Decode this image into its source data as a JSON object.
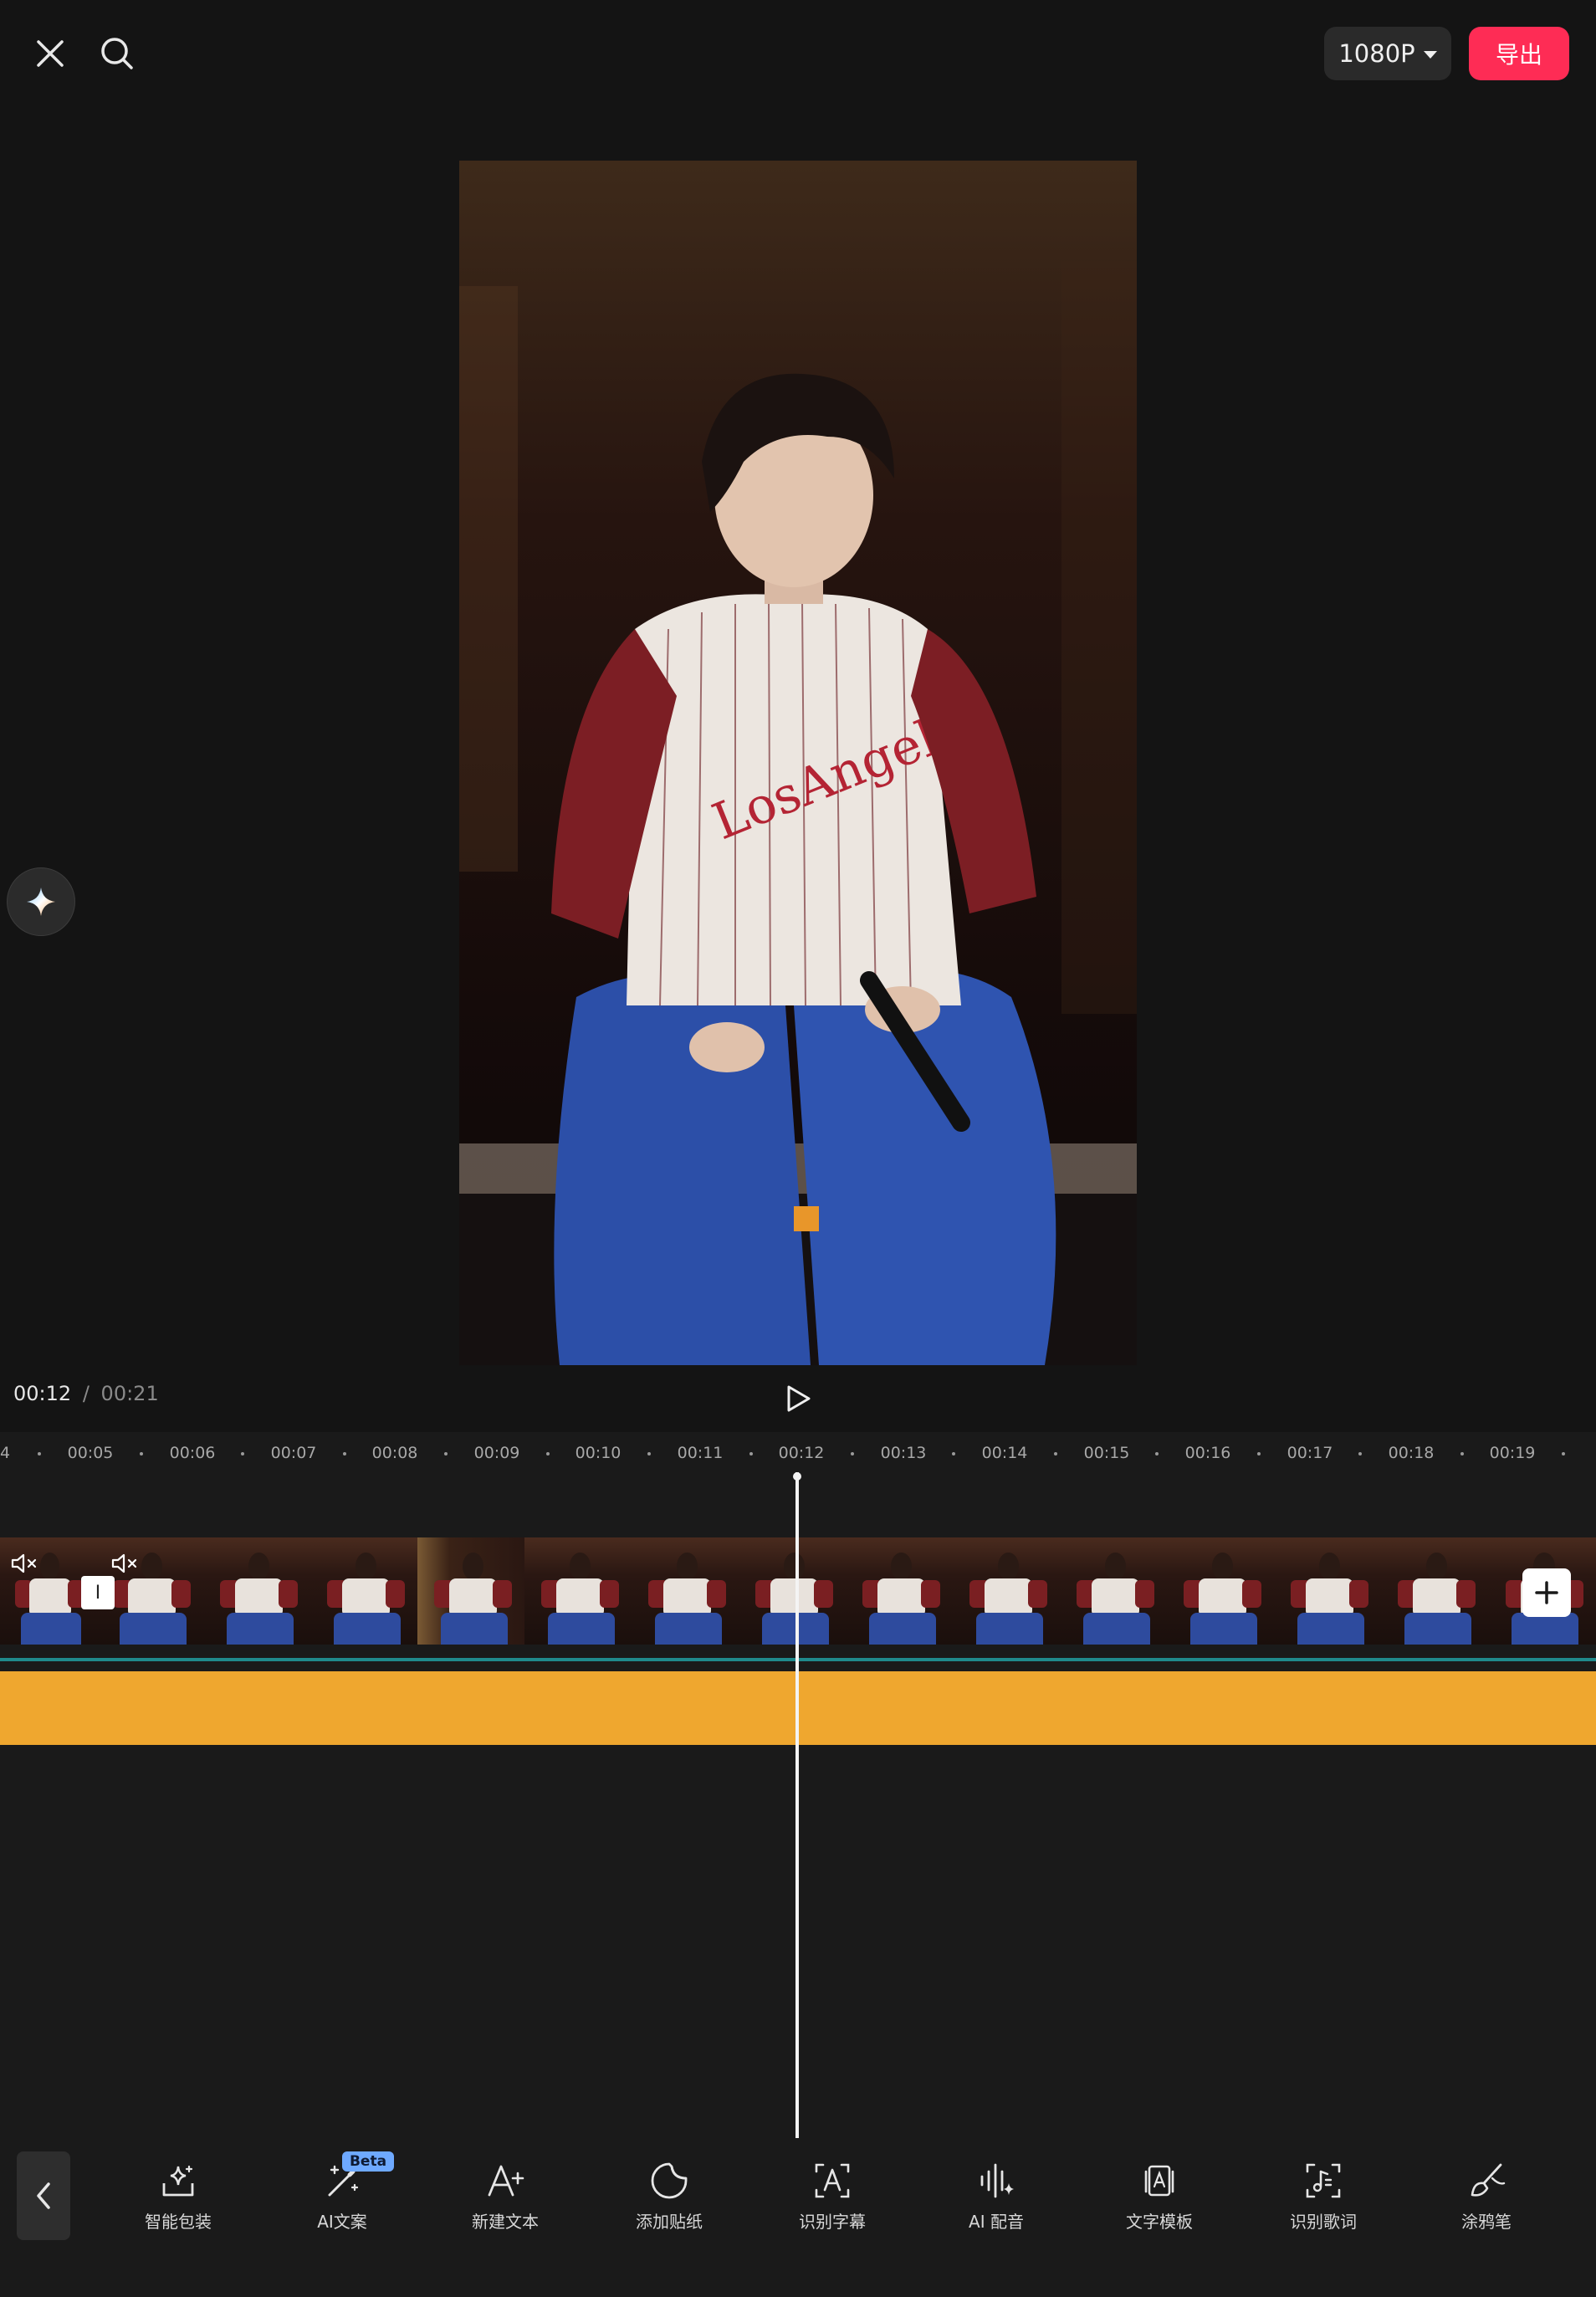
{
  "top_bar": {
    "close_icon": "close-icon",
    "search_icon": "search-icon",
    "resolution_label": "1080P",
    "export_label": "导出",
    "export_color": "#fe2c55"
  },
  "preview": {
    "description_icon": "video-frame",
    "ai_float_icon": "sparkle-icon"
  },
  "playback": {
    "current_time": "00:12",
    "separator": "/",
    "total_time": "00:21",
    "play_icon": "play-icon"
  },
  "ruler": {
    "leading_label": "4",
    "labels": [
      "00:05",
      "00:06",
      "00:07",
      "00:08",
      "00:09",
      "00:10",
      "00:11",
      "00:12",
      "00:13",
      "00:14",
      "00:15",
      "00:16",
      "00:17",
      "00:18",
      "00:19"
    ]
  },
  "timeline": {
    "audio_color": "#efa72f",
    "track_line_color": "#1f8a8c",
    "transition_marker": "I",
    "add_clip_icon": "plus-icon",
    "mute_icon": "mute-icon"
  },
  "toolbar": {
    "back_icon": "chevron-left-icon",
    "beta_label": "Beta",
    "tools": [
      {
        "label": "智能包装",
        "icon": "magic-pack-icon"
      },
      {
        "label": "AI文案",
        "icon": "magic-wand-icon"
      },
      {
        "label": "新建文本",
        "icon": "add-text-icon"
      },
      {
        "label": "添加贴纸",
        "icon": "sticker-icon"
      },
      {
        "label": "识别字幕",
        "icon": "caption-icon"
      },
      {
        "label": "AI 配音",
        "icon": "voice-icon"
      },
      {
        "label": "文字模板",
        "icon": "text-template-icon"
      },
      {
        "label": "识别歌词",
        "icon": "lyrics-icon"
      },
      {
        "label": "涂鸦笔",
        "icon": "brush-icon"
      }
    ]
  }
}
